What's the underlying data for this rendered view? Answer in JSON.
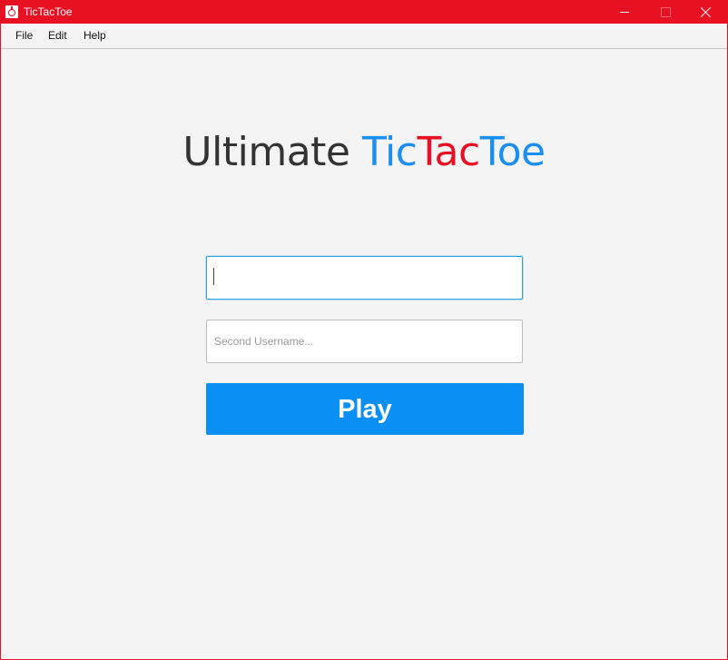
{
  "window": {
    "title": "TicTacToe",
    "accent": "#e81123"
  },
  "menu": {
    "file": "File",
    "edit": "Edit",
    "help": "Help"
  },
  "heading": {
    "ultimate": "Ultimate",
    "tic": "Tic",
    "tac": "Tac",
    "toe": "Toe",
    "tic_color": "#1a8ff0",
    "tac_color": "#e81123"
  },
  "form": {
    "first_username": {
      "value": "",
      "placeholder": ""
    },
    "second_username": {
      "value": "",
      "placeholder": "Second Username..."
    },
    "play_label": "Play",
    "play_color": "#0a8ff5"
  },
  "icons": [
    "app-icon",
    "minimize-icon",
    "maximize-icon",
    "close-icon"
  ]
}
